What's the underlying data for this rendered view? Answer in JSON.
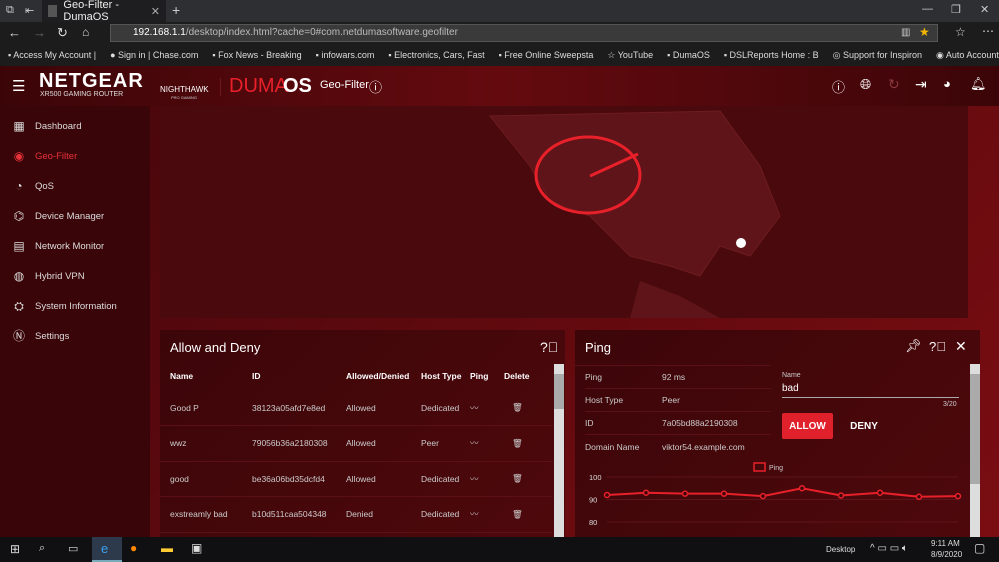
{
  "browser": {
    "tab_title": "Geo-Filter - DumaOS",
    "url_host": "192.168.1.1",
    "url_path": "/desktop/index.html?cache=0#com.netdumasoftware.geofilter",
    "bookmarks": [
      "Access My Account |",
      "Sign in | Chase.com",
      "Fox News - Breaking",
      "infowars.com",
      "Electronics, Cars, Fast",
      "Free Online Sweepsta",
      "YouTube",
      "DumaOS",
      "DSLReports Home : B",
      "Support for Inspiron",
      "Auto Account Log In"
    ]
  },
  "header": {
    "brand": "NETGEAR",
    "model": "XR500 GAMING ROUTER",
    "nighthawk": "NIGHTHAWK",
    "nighthawk_sub": "PRO GAMING",
    "duma": "DUMA",
    "os": "OS",
    "page": "Geo-Filter"
  },
  "sidebar": {
    "items": [
      {
        "label": "Dashboard",
        "icon": "dashboard-icon"
      },
      {
        "label": "Geo-Filter",
        "icon": "geofilter-icon",
        "active": true
      },
      {
        "label": "QoS",
        "icon": "qos-icon"
      },
      {
        "label": "Device Manager",
        "icon": "device-manager-icon"
      },
      {
        "label": "Network Monitor",
        "icon": "network-monitor-icon"
      },
      {
        "label": "Hybrid VPN",
        "icon": "vpn-icon"
      },
      {
        "label": "System Information",
        "icon": "info-icon"
      },
      {
        "label": "Settings",
        "icon": "settings-icon"
      }
    ]
  },
  "allow_deny": {
    "title": "Allow and Deny",
    "columns": [
      "Name",
      "ID",
      "Allowed/Denied",
      "Host Type",
      "Ping",
      "Delete"
    ],
    "rows": [
      {
        "name": "Good P",
        "id": "38123a05afd7e8ed",
        "status": "Allowed",
        "host": "Dedicated"
      },
      {
        "name": "wwz",
        "id": "79056b36a2180308",
        "status": "Allowed",
        "host": "Peer"
      },
      {
        "name": "good",
        "id": "be36a06bd35dcfd4",
        "status": "Allowed",
        "host": "Dedicated"
      },
      {
        "name": "exstreamly bad",
        "id": "b10d511caa504348",
        "status": "Denied",
        "host": "Dedicated"
      }
    ]
  },
  "ping_panel": {
    "title": "Ping",
    "fields": [
      {
        "k": "Ping",
        "v": "92 ms"
      },
      {
        "k": "Host Type",
        "v": "Peer"
      },
      {
        "k": "ID",
        "v": "7a05bd88a2190308"
      },
      {
        "k": "Domain Name",
        "v": "viktor54.example.com"
      }
    ],
    "name_label": "Name",
    "name_value": "bad",
    "counter": "3/20",
    "allow": "ALLOW",
    "deny": "DENY"
  },
  "chart_data": {
    "type": "line",
    "series": [
      {
        "name": "Ping",
        "values": [
          92,
          93,
          92.6,
          92.6,
          91.5,
          95,
          91.8,
          93,
          91.2,
          91.5
        ],
        "color": "#e8202a"
      }
    ],
    "y_ticks": [
      "100",
      "90",
      "80"
    ],
    "ylim": [
      80,
      100
    ],
    "legend": "top",
    "grid": true
  },
  "taskbar": {
    "desktop": "Desktop",
    "time": "9:11 AM",
    "date": "8/9/2020"
  },
  "colors": {
    "accent": "#e8202a",
    "bg": "#3a0508"
  }
}
